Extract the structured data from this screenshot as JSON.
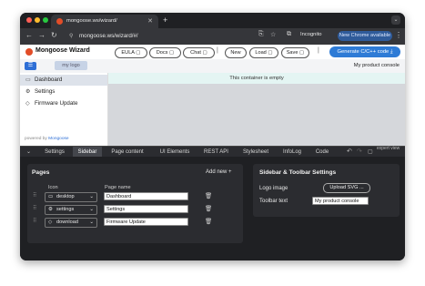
{
  "browser": {
    "tab_title": "mongoose.ws/wizard/",
    "url": "mongoose.ws/wizard/#/",
    "profile": "Incognito",
    "update_button": "New Chrome available"
  },
  "header": {
    "brand": "Mongoose Wizard",
    "buttons": [
      "EULA",
      "Docs",
      "Chat",
      "New",
      "Load",
      "Save"
    ],
    "generate_button": "Generate C/C++ code"
  },
  "preview": {
    "logo_placeholder": "my logo",
    "console_title": "My product console",
    "nav_items": [
      {
        "label": "Dashboard",
        "icon": "monitor-icon"
      },
      {
        "label": "Settings",
        "icon": "gear-icon"
      },
      {
        "label": "Firmware Update",
        "icon": "download-icon"
      }
    ],
    "empty_message": "This container is empty",
    "powered_by_prefix": "powered by",
    "powered_by_link": "Mongoose"
  },
  "bottom_tabs": [
    "Settings",
    "Sidebar",
    "Page content",
    "UI Elements",
    "REST API",
    "Stylesheet",
    "InfoLog",
    "Code"
  ],
  "active_tab": "Sidebar",
  "expert_view": "expert view",
  "pages_panel": {
    "title": "Pages",
    "add_new": "Add new",
    "col_icon": "Icon",
    "col_name": "Page name",
    "rows": [
      {
        "icon": "desktop",
        "name": "Dashboard"
      },
      {
        "icon": "settings",
        "name": "Settings"
      },
      {
        "icon": "download",
        "name": "Firmware Update"
      }
    ]
  },
  "sidebar_settings": {
    "title": "Sidebar & Toolbar Settings",
    "logo_label": "Logo image",
    "upload_button": "Upload SVG ...",
    "toolbar_label": "Toolbar text",
    "toolbar_value": "My product console"
  }
}
